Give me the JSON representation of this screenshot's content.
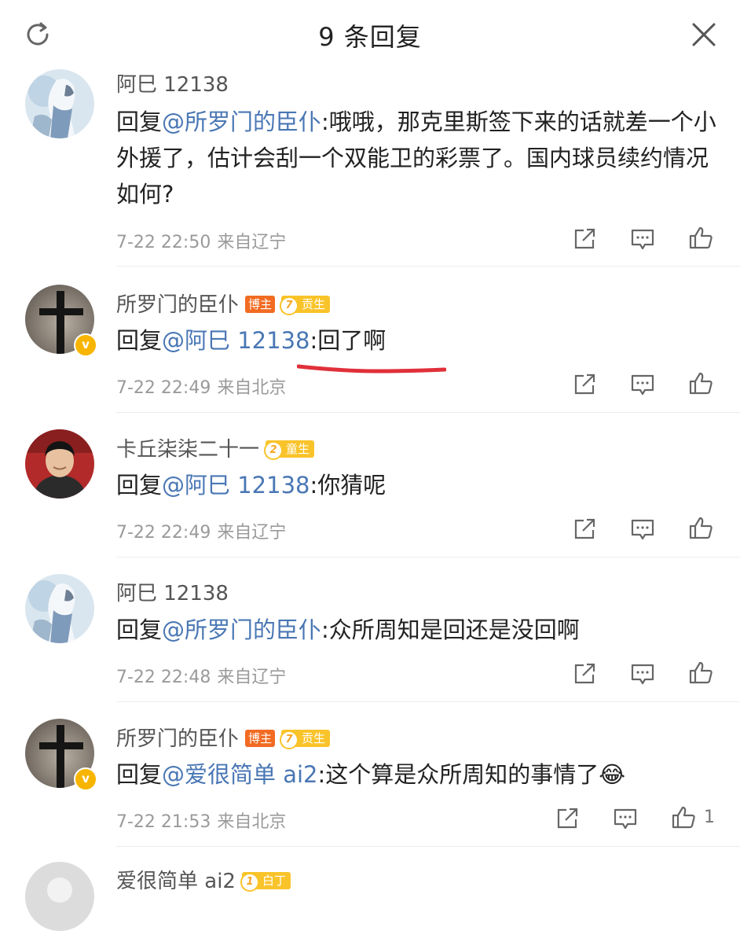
{
  "header": {
    "title": "9 条回复"
  },
  "comments": [
    {
      "user": "阿巳 12138",
      "reply_prefix": "回复",
      "mention": "@所罗门的臣仆",
      "text": ":哦哦，那克里斯签下来的话就差一个小外援了，估计会刮一个双能卫的彩票了。国内球员续约情况如何?",
      "time": "7-22 22:50",
      "source": "来自辽宁"
    },
    {
      "user": "所罗门的臣仆",
      "badge_bozhu": "博主",
      "level_num": "7",
      "level_label": "贡生",
      "reply_prefix": "回复",
      "mention": "@阿巳 12138",
      "text": ":回了啊",
      "time": "7-22 22:49",
      "source": "来自北京"
    },
    {
      "user": "卡丘柒柒二十一",
      "level_num": "2",
      "level_label": "童生",
      "reply_prefix": "回复",
      "mention": "@阿巳 12138",
      "text": ":你猜呢",
      "time": "7-22 22:49",
      "source": "来自辽宁"
    },
    {
      "user": "阿巳 12138",
      "reply_prefix": "回复",
      "mention": "@所罗门的臣仆",
      "text": ":众所周知是回还是没回啊",
      "time": "7-22 22:48",
      "source": "来自辽宁"
    },
    {
      "user": "所罗门的臣仆",
      "badge_bozhu": "博主",
      "level_num": "7",
      "level_label": "贡生",
      "reply_prefix": "回复",
      "mention": "@爱很简单 ai2",
      "text": ":这个算是众所周知的事情了😂",
      "time": "7-22 21:53",
      "source": "来自北京",
      "like_count": "1"
    },
    {
      "user": "爱很简单 ai2",
      "level_num": "1",
      "level_label": "白丁"
    }
  ],
  "colors": {
    "mention": "#4a77b4",
    "bozhu_badge": "#f26b22",
    "level_badge": "#f9c32a",
    "verified_badge": "#f7b500",
    "underline": "#e0303a"
  }
}
